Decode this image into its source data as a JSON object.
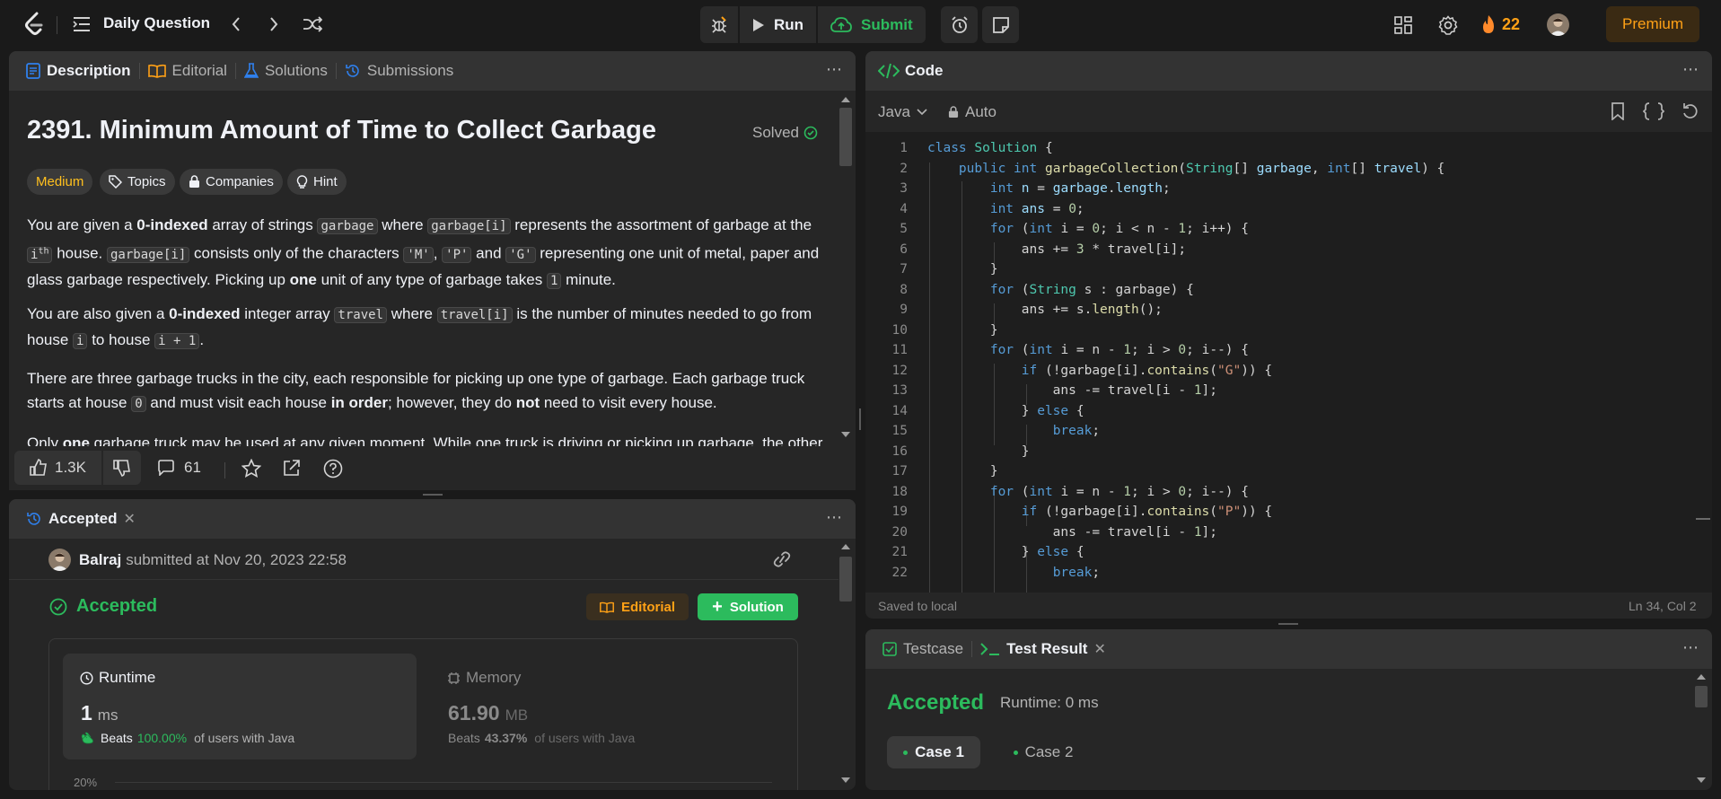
{
  "topbar": {
    "title": "Daily Question",
    "run_label": "Run",
    "submit_label": "Submit",
    "streak": "22",
    "premium_label": "Premium"
  },
  "description": {
    "tabs": [
      {
        "label": "Description"
      },
      {
        "label": "Editorial"
      },
      {
        "label": "Solutions"
      },
      {
        "label": "Submissions"
      }
    ],
    "title": "2391. Minimum Amount of Time to Collect Garbage",
    "solved": "Solved",
    "difficulty": "Medium",
    "chips": [
      "Topics",
      "Companies",
      "Hint"
    ],
    "likes": "1.3K",
    "comments": "61"
  },
  "submission": {
    "tab_label": "Accepted",
    "user": "Balraj",
    "submitted_text": "submitted at Nov 20, 2023 22:58",
    "status": "Accepted",
    "editorial_btn": "Editorial",
    "solution_btn": "Solution",
    "runtime": {
      "label": "Runtime",
      "value": "1",
      "unit": "ms",
      "beats_prefix": "Beats",
      "beats": "100.00%",
      "beats_suffix": "of users with Java"
    },
    "memory": {
      "label": "Memory",
      "value": "61.90",
      "unit": "MB",
      "beats_prefix": "Beats",
      "beats": "43.37%",
      "beats_suffix": "of users with Java"
    },
    "chart_tick": "20%"
  },
  "code": {
    "header": "Code",
    "language": "Java",
    "auto": "Auto",
    "saved": "Saved to local",
    "position": "Ln 34, Col 2"
  },
  "testresult": {
    "tabs": [
      {
        "label": "Testcase"
      },
      {
        "label": "Test Result"
      }
    ],
    "status": "Accepted",
    "runtime": "Runtime: 0 ms",
    "cases": [
      "Case 1",
      "Case 2"
    ]
  },
  "colors": {
    "accent_orange": "#ffa116",
    "green": "#2cbb5d",
    "medium": "#ffc01e",
    "blue": "#2f80ed"
  }
}
